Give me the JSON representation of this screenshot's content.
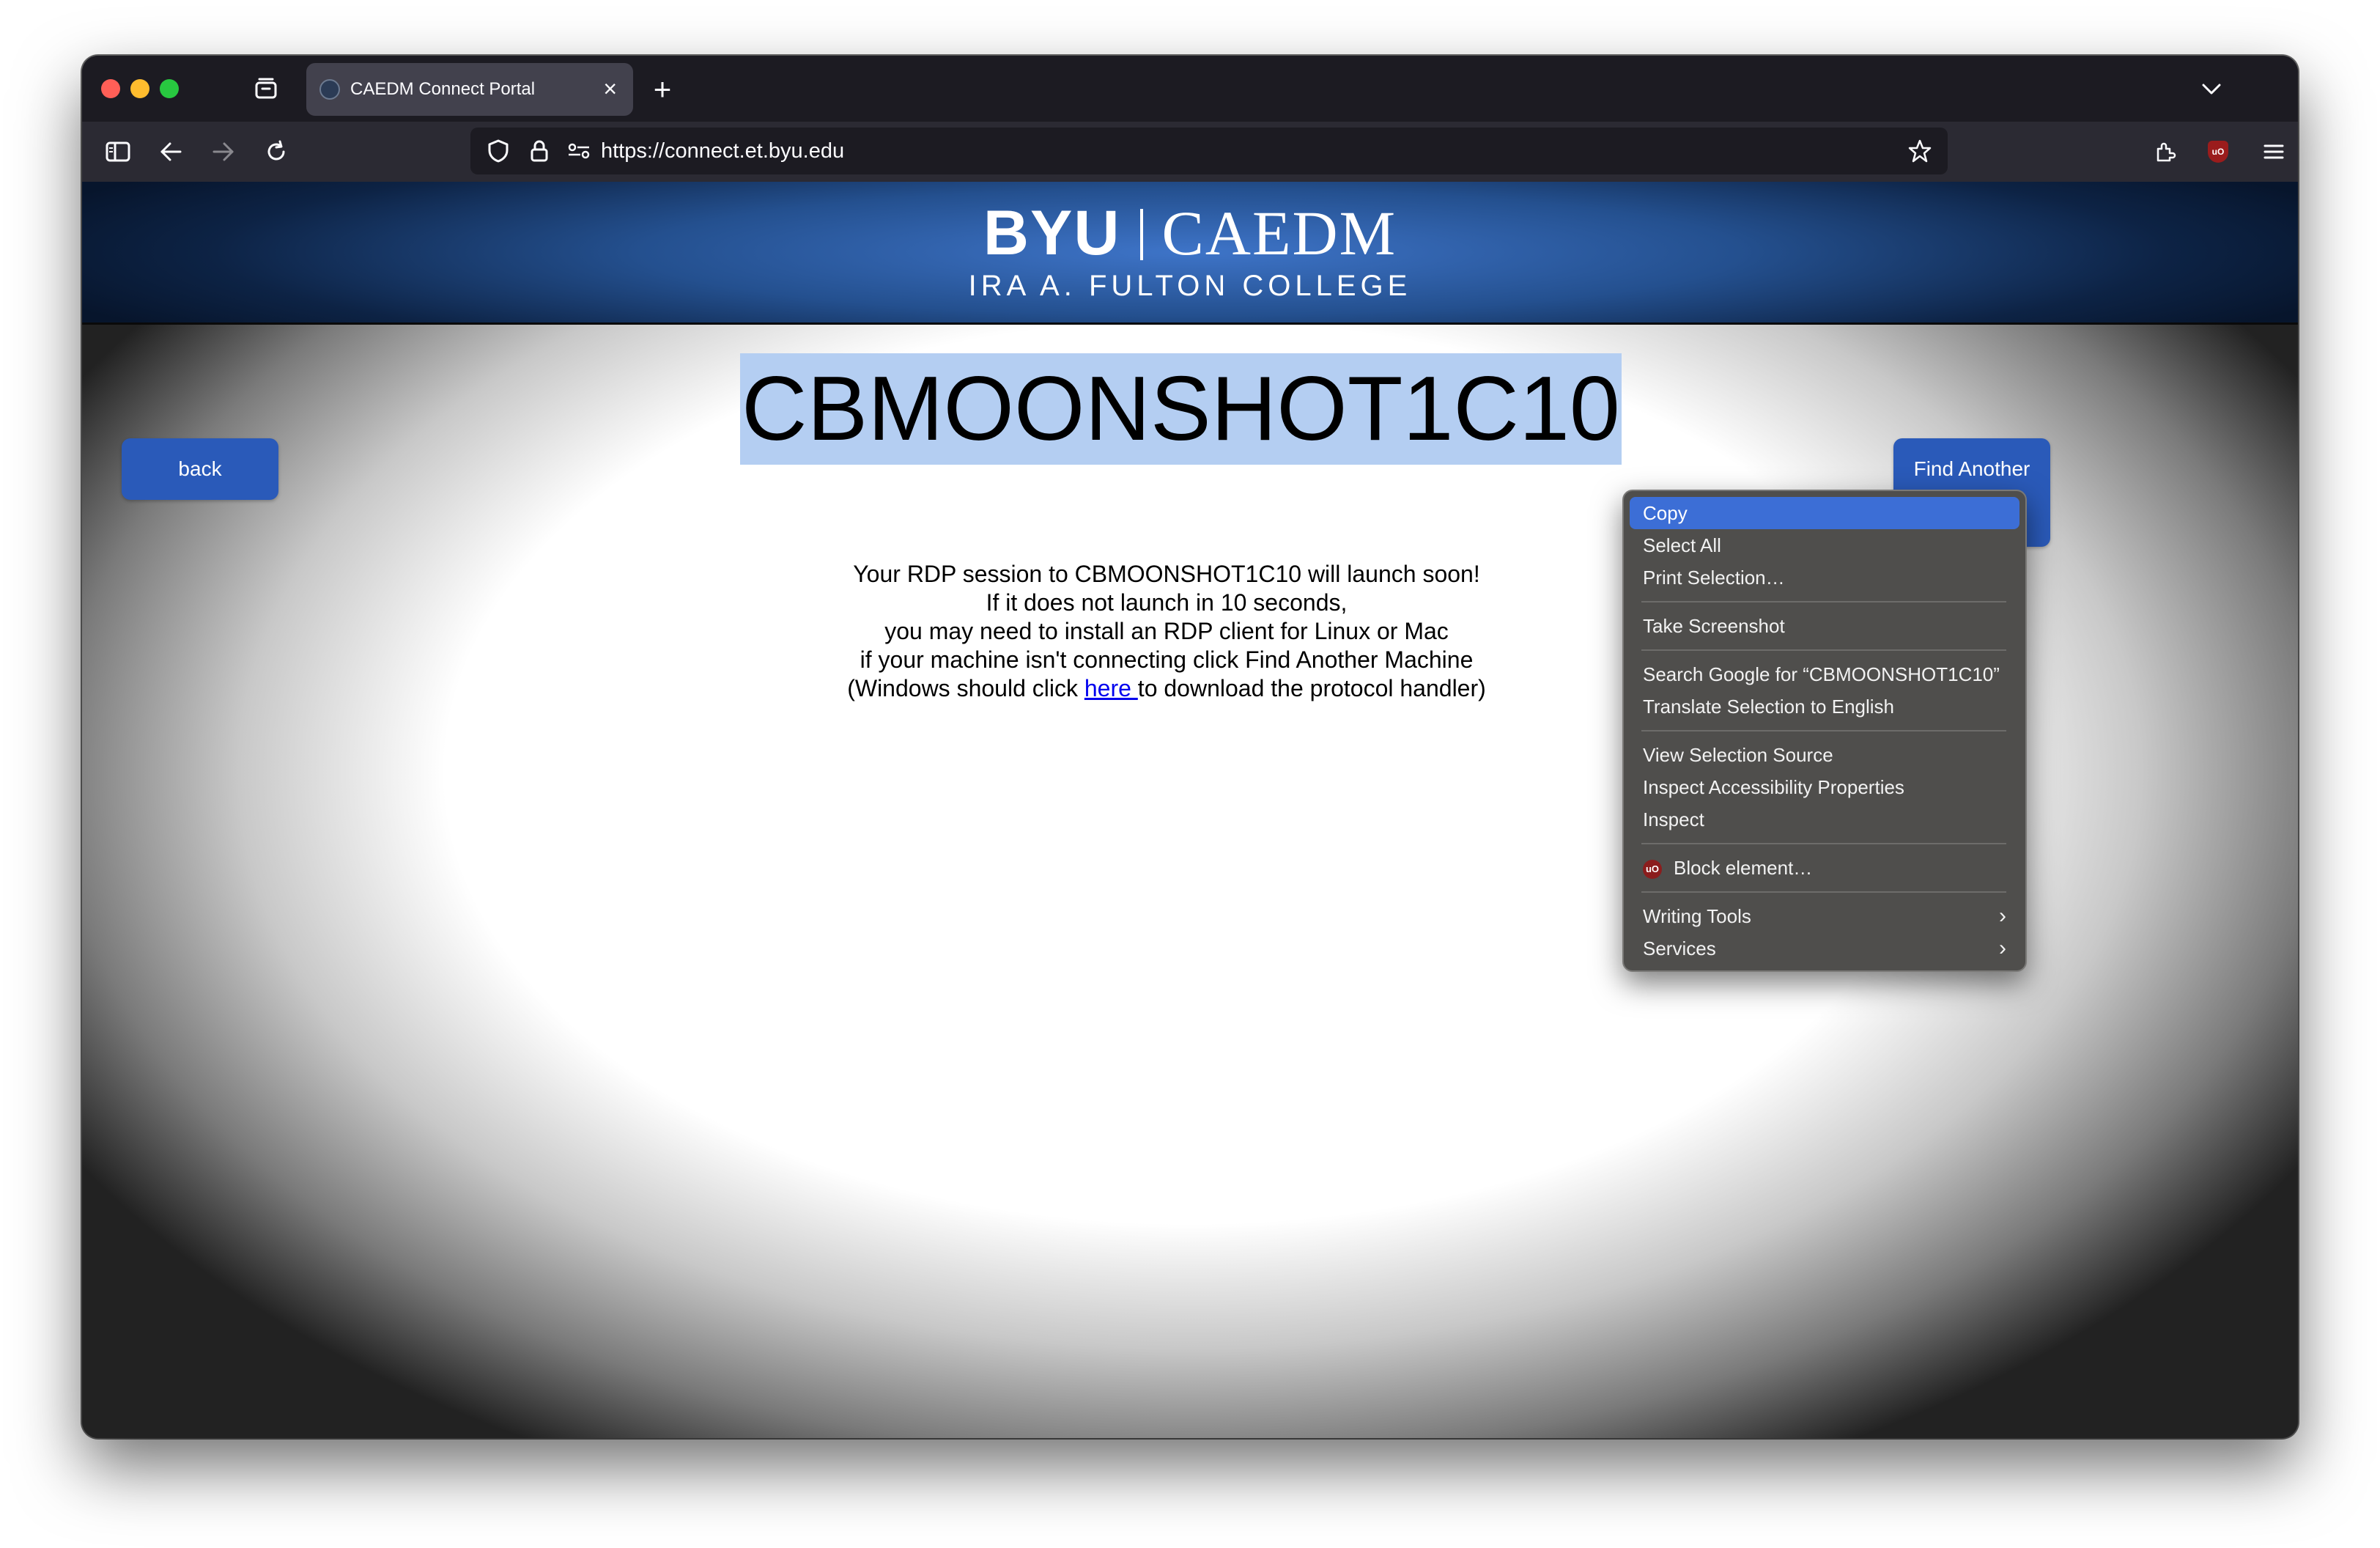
{
  "browser": {
    "tab_title": "CAEDM Connect Portal",
    "tab_close": "×",
    "new_tab": "+",
    "url": "https://connect.et.byu.edu",
    "icons": {
      "sidebar": "sidebar-icon",
      "back": "back-arrow-icon",
      "forward": "forward-arrow-icon",
      "reload": "reload-icon",
      "shield": "tracking-protection-icon",
      "lock": "lock-icon",
      "permissions": "permissions-icon",
      "bookmark": "star-icon",
      "extensions": "extensions-icon",
      "ublock": "ublock-icon",
      "menu": "hamburger-menu-icon",
      "tab_list": "chevron-down-icon",
      "tab_manager": "tab-manager-icon"
    },
    "ublock_label": "uO"
  },
  "banner": {
    "logo_byu": "BYU",
    "logo_caedm": "CAEDM",
    "college": "IRA A. FULTON COLLEGE"
  },
  "page": {
    "back_label": "back",
    "find_label": "Find Another",
    "machine_name": "CBMOONSHOT1C10",
    "message_lines": [
      "Your RDP session to CBMOONSHOT1C10 will launch soon!",
      "If it does not launch in 10 seconds,",
      "you may need to install an RDP client for Linux or Mac",
      "if your machine isn't connecting click Find Another Machine"
    ],
    "windows_prefix": "(Windows should click ",
    "windows_link": "here ",
    "windows_suffix": "to download the protocol handler)"
  },
  "context_menu": {
    "copy": "Copy",
    "select_all": "Select All",
    "print_selection": "Print Selection…",
    "take_screenshot": "Take Screenshot",
    "search_google": "Search Google for “CBMOONSHOT1C10”",
    "translate": "Translate Selection to English",
    "view_source": "View Selection Source",
    "inspect_a11y": "Inspect Accessibility Properties",
    "inspect": "Inspect",
    "block_element": "Block element…",
    "writing_tools": "Writing Tools",
    "services": "Services"
  },
  "colors": {
    "button_blue": "#2a5ab9",
    "selection": "#b4cef2",
    "menu_highlight": "#3c6ed6"
  }
}
